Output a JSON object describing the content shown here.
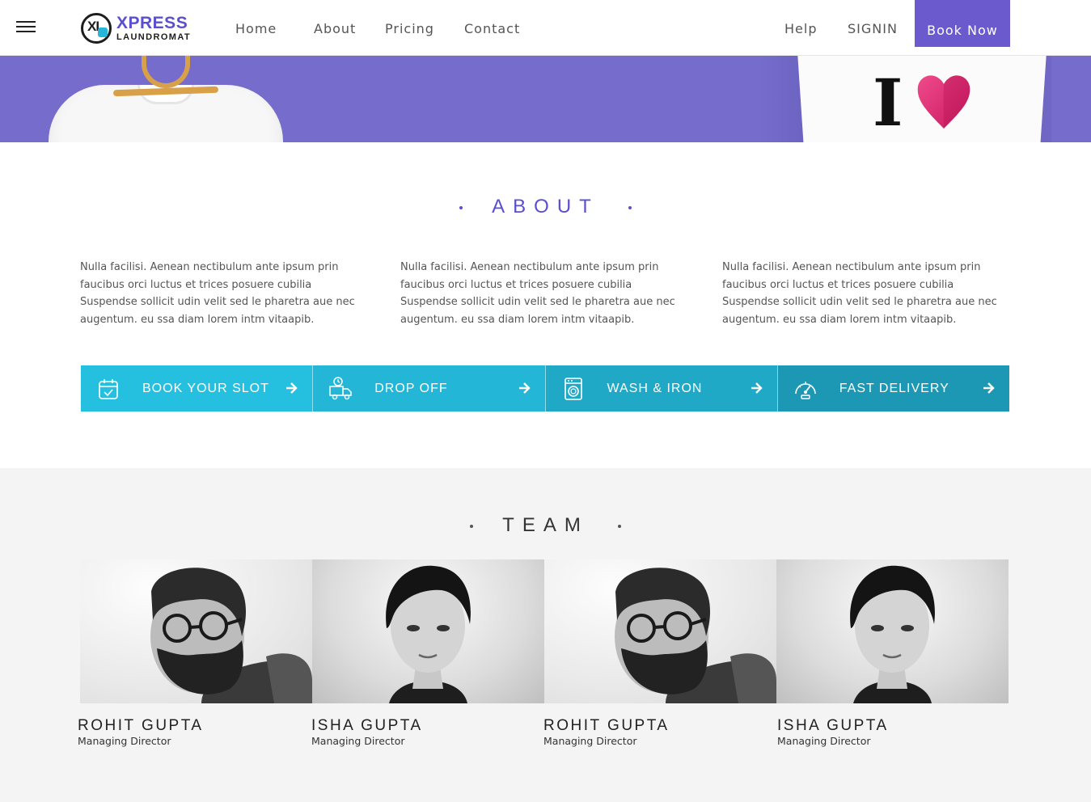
{
  "brand": {
    "mark": "XL",
    "name_top": "XPRESS",
    "name_bottom": "LAUNDROMAT",
    "accent_color": "#5a4fcf"
  },
  "nav": {
    "menu_icon": "hamburger-icon",
    "links": [
      "Home",
      "About",
      "Pricing",
      "Contact"
    ],
    "help": "Help",
    "signin": "SIGNIN",
    "cta": "Book Now"
  },
  "hero": {
    "tee_text": "I"
  },
  "about": {
    "title": "ABOUT",
    "paragraphs": [
      "Nulla facilisi. Aenean nectibulum ante ipsum prin faucibus orci luctus et trices posuere cubilia Suspendse sollicit udin velit sed le pharetra aue nec augentum. eu ssa diam lorem intm vitaapib.",
      "Nulla facilisi. Aenean nectibulum ante ipsum prin faucibus orci luctus et trices posuere cubilia Suspendse sollicit udin velit sed le pharetra aue nec augentum. eu ssa diam lorem intm vitaapib.",
      "Nulla facilisi. Aenean nectibulum ante ipsum prin faucibus orci luctus et trices posuere cubilia Suspendse sollicit udin velit sed le pharetra aue nec augentum. eu ssa diam lorem intm vitaapib."
    ]
  },
  "services": [
    {
      "label": "BOOK YOUR SLOT",
      "icon": "calendar-check-icon",
      "color": "#25c0df"
    },
    {
      "label": "DROP OFF",
      "icon": "delivery-truck-icon",
      "color": "#23b6d7"
    },
    {
      "label": "WASH & IRON",
      "icon": "washing-machine-icon",
      "color": "#20a9c6"
    },
    {
      "label": "FAST DELIVERY",
      "icon": "speedometer-icon",
      "color": "#1c97b4"
    }
  ],
  "team": {
    "title": "TEAM",
    "members": [
      {
        "name": "ROHIT GUPTA",
        "role": "Managing Director"
      },
      {
        "name": "ISHA GUPTA",
        "role": "Managing Director"
      },
      {
        "name": "ROHIT GUPTA",
        "role": "Managing Director"
      },
      {
        "name": "ISHA GUPTA",
        "role": "Managing Director"
      }
    ]
  }
}
